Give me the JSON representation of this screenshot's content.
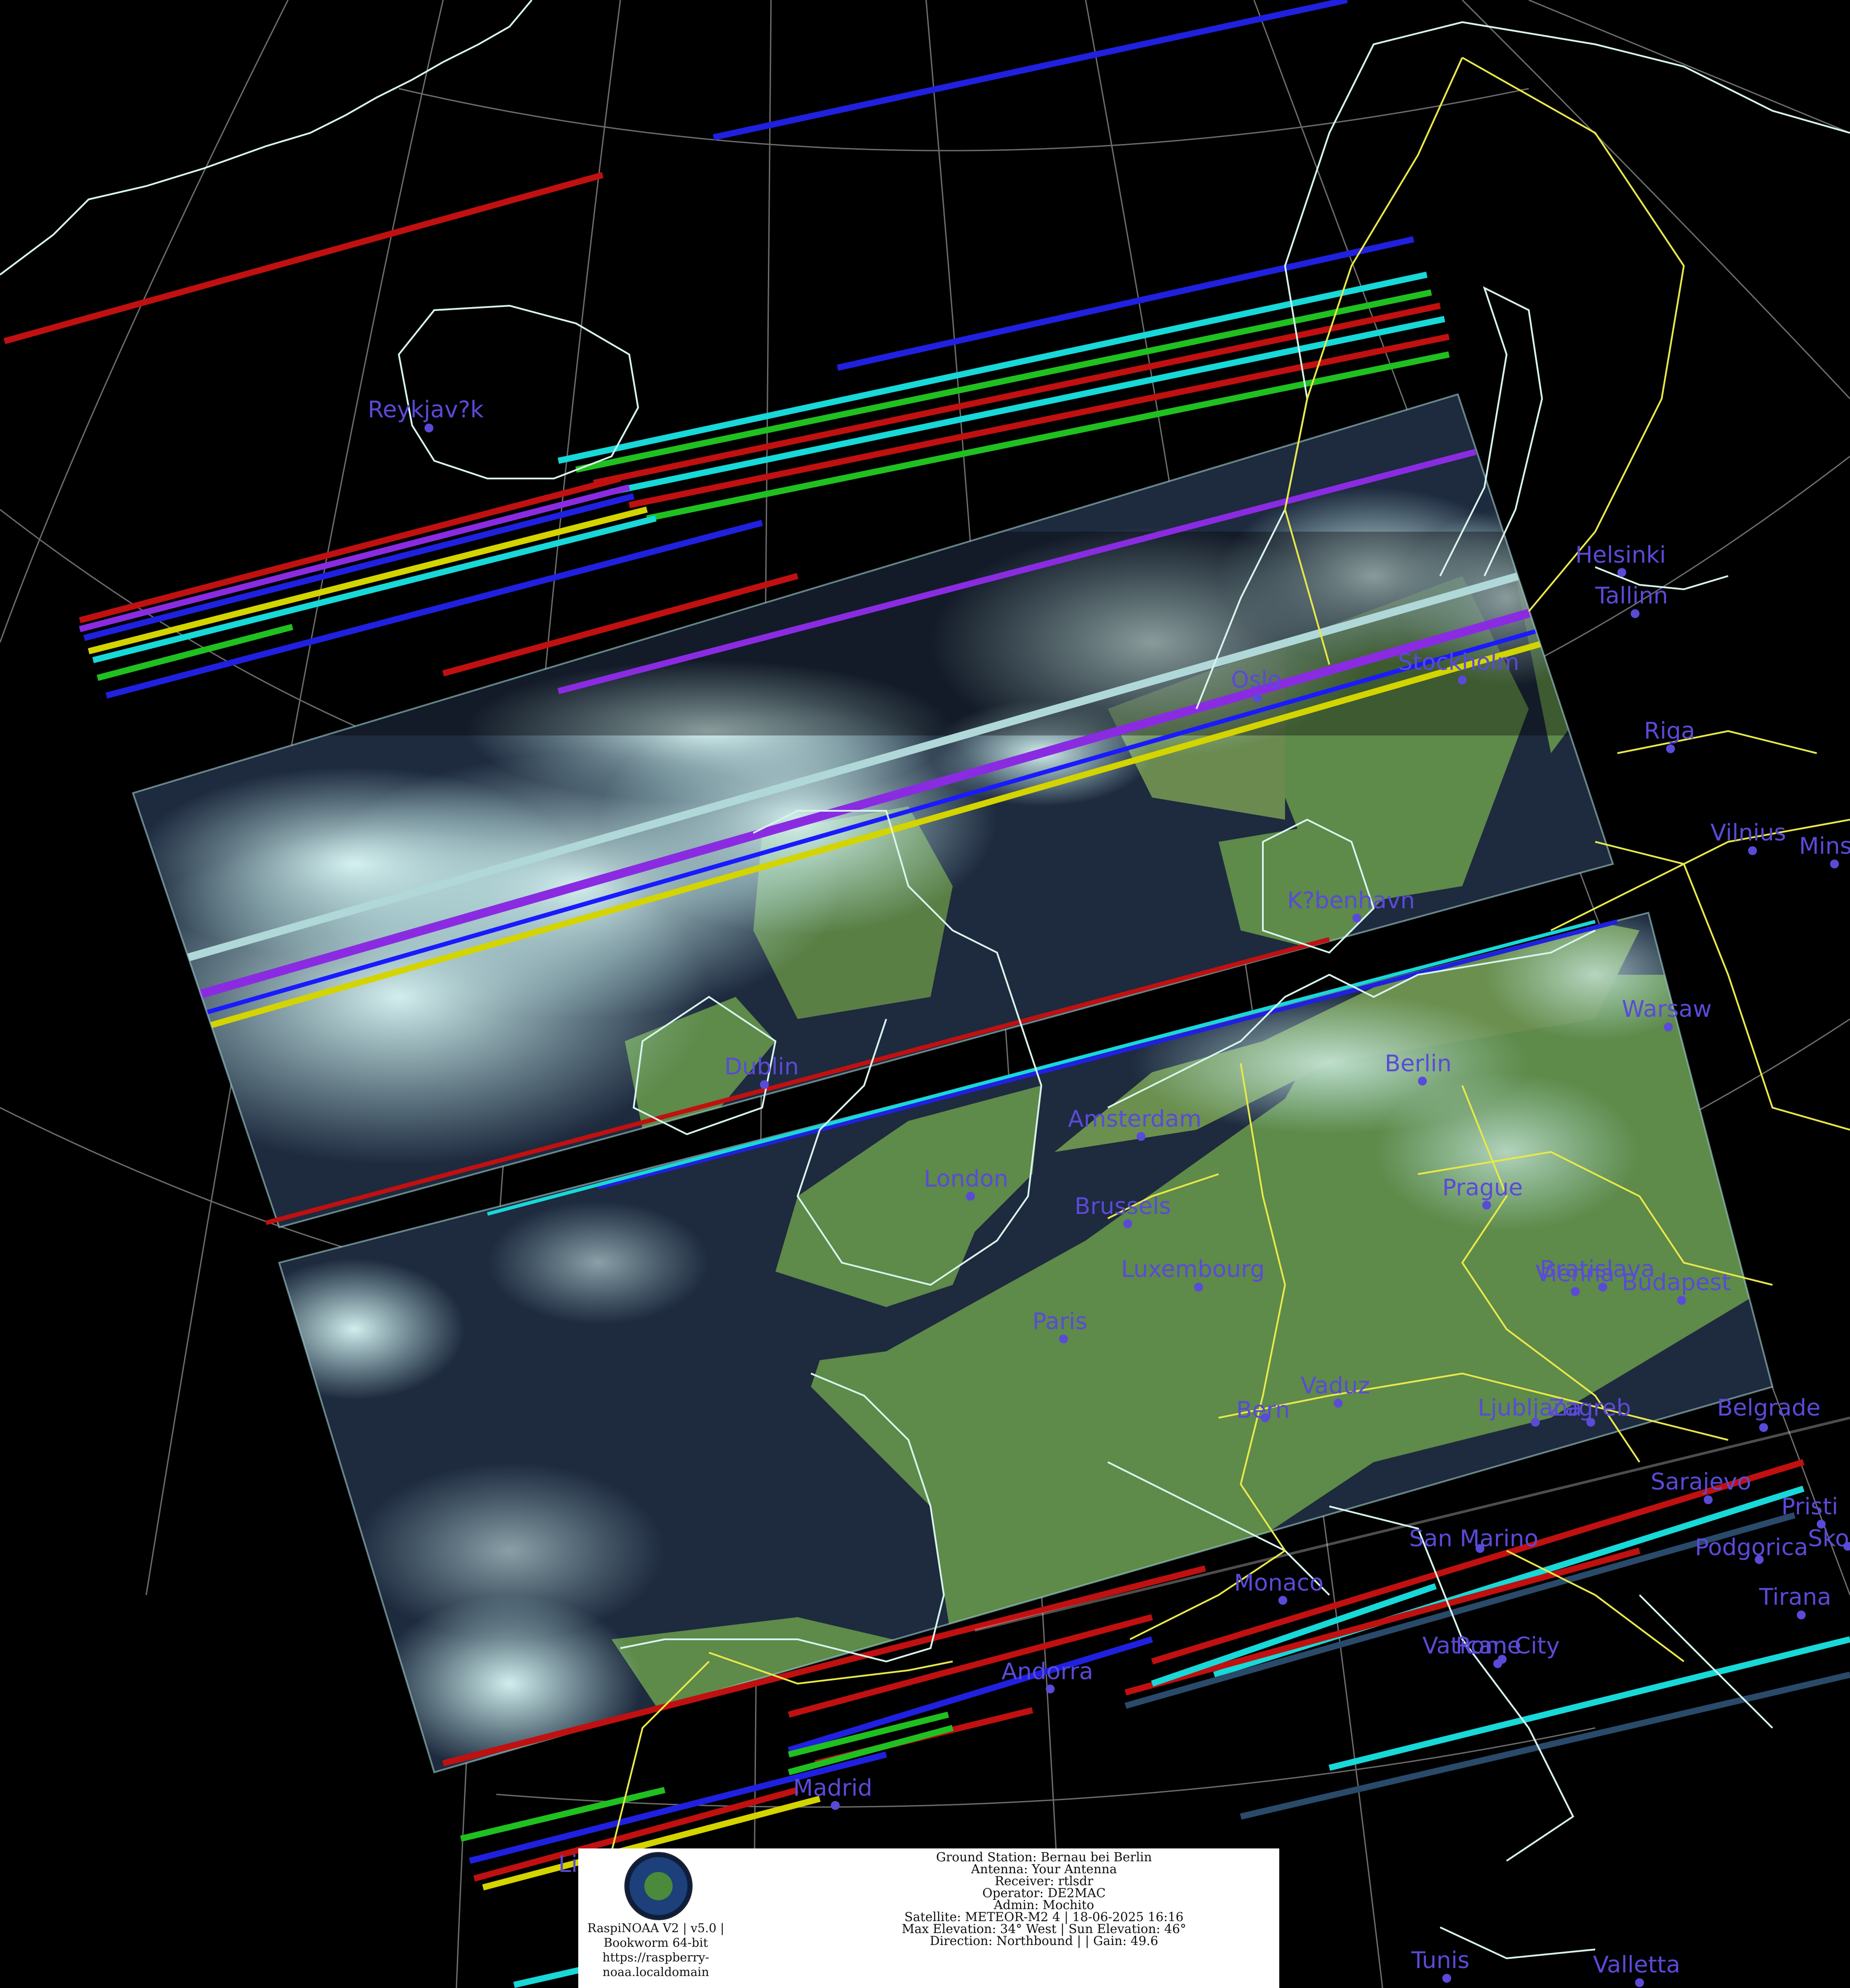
{
  "cities": [
    {
      "name": "Reykjav?k"
    },
    {
      "name": "Helsinki"
    },
    {
      "name": "Tallinn"
    },
    {
      "name": "Stockholm"
    },
    {
      "name": "Oslo"
    },
    {
      "name": "Riga"
    },
    {
      "name": "Vilnius"
    },
    {
      "name": "Mins"
    },
    {
      "name": "K?benhavn"
    },
    {
      "name": "Warsaw"
    },
    {
      "name": "Dublin"
    },
    {
      "name": "Berlin"
    },
    {
      "name": "Amsterdam"
    },
    {
      "name": "London"
    },
    {
      "name": "Brussels"
    },
    {
      "name": "Prague"
    },
    {
      "name": "Luxembourg"
    },
    {
      "name": "Bratislava"
    },
    {
      "name": "Vienna"
    },
    {
      "name": "Budapest"
    },
    {
      "name": "Paris"
    },
    {
      "name": "Vaduz"
    },
    {
      "name": "Bern"
    },
    {
      "name": "Ljubljana"
    },
    {
      "name": "Zagreb"
    },
    {
      "name": "Belgrade"
    },
    {
      "name": "Sarajevo"
    },
    {
      "name": "Pristi"
    },
    {
      "name": "San Marino"
    },
    {
      "name": "Podgorica"
    },
    {
      "name": "Sko"
    },
    {
      "name": "Monaco"
    },
    {
      "name": "Tirana"
    },
    {
      "name": "Vatican City"
    },
    {
      "name": "Rome"
    },
    {
      "name": "Andorra"
    },
    {
      "name": "Madrid"
    },
    {
      "name": "Li"
    },
    {
      "name": "Tunis"
    },
    {
      "name": "Valletta"
    }
  ],
  "info": {
    "logo_line1": "RaspiNOAA V2 | v5.0 |",
    "logo_line2": "Bookworm 64-bit",
    "logo_line3": "https://raspberry-",
    "logo_line4": "noaa.localdomain",
    "ground_station": "Ground Station: Bernau bei Berlin",
    "antenna": "Antenna: Your Antenna",
    "receiver": "Receiver: rtlsdr",
    "operator": "Operator: DE2MAC",
    "admin": "Admin: Mochito",
    "satellite": "Satellite: METEOR-M2 4 | 18-06-2025 16:16",
    "elevation": "Max Elevation: 34° West | Sun Elevation: 46°",
    "direction": "Direction: Northbound | | Gain: 49.6"
  },
  "colors": {
    "background": "#000000",
    "coastline": "#d8f4ec",
    "border": "#e8e84a",
    "graticule": "#9a9a9a",
    "city": "#5a4ad8",
    "land": "#5e8a4a",
    "cloud": "#bfeeee",
    "sea": "#1e2a3e"
  }
}
